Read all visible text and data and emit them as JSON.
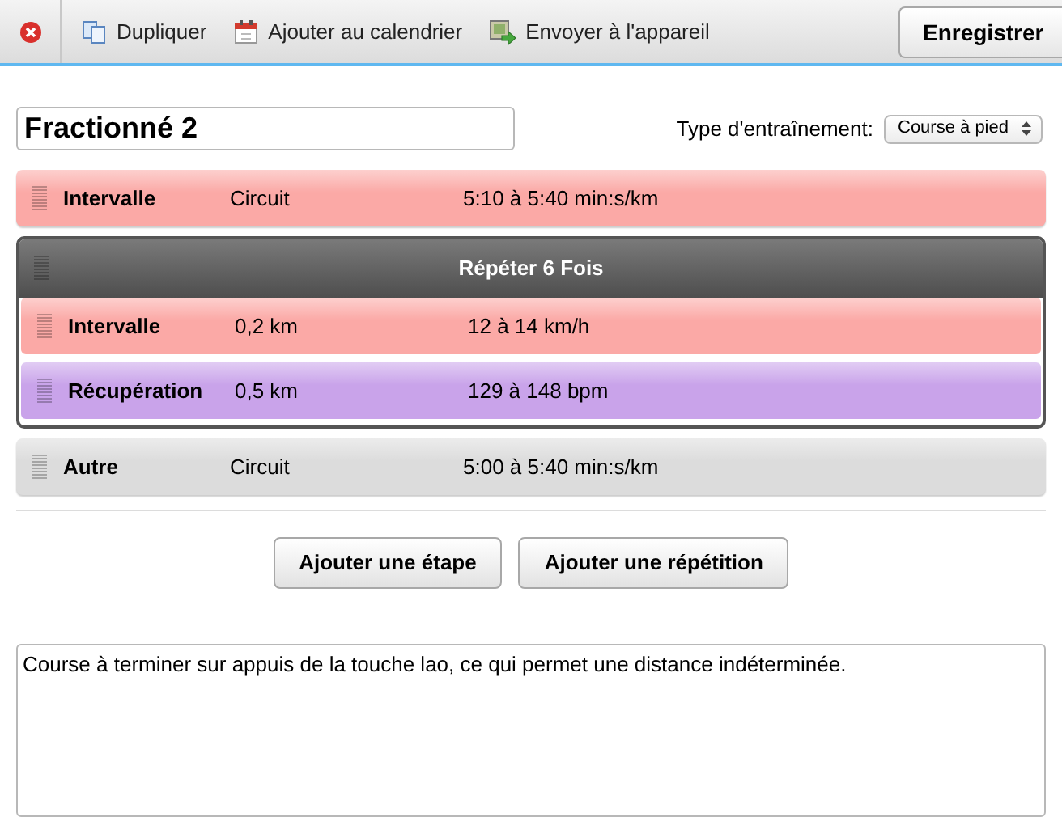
{
  "toolbar": {
    "actions": [
      {
        "kind": "duplicate",
        "label": "Dupliquer"
      },
      {
        "kind": "calendar",
        "label": "Ajouter au calendrier"
      },
      {
        "kind": "send",
        "label": "Envoyer à l'appareil"
      }
    ],
    "save_button": "Enregistrer"
  },
  "workout_name": {
    "value": "Fractionné 2"
  },
  "workout_type": {
    "label": "Type d'entraînement:",
    "value": "Course à pied"
  },
  "steps": [
    {
      "kind": "step",
      "color": "#fba9a6",
      "name": "Intervalle",
      "duration": "Circuit",
      "target": "5:10 à 5:40 min:s/km"
    },
    {
      "kind": "repeat",
      "label": "Répéter 6 Fois",
      "children": [
        {
          "kind": "step",
          "color": "#fba9a6",
          "name": "Intervalle",
          "duration": "0,2 km",
          "target": "12 à 14 km/h"
        },
        {
          "kind": "step",
          "color": "#c9a3ea",
          "name": "Récupération",
          "duration": "0,5 km",
          "target": "129 à 148 bpm"
        }
      ]
    },
    {
      "kind": "step",
      "color": "#dcdcdc",
      "name": "Autre",
      "duration": "Circuit",
      "target": "5:00 à 5:40 min:s/km"
    }
  ],
  "buttons": [
    "Ajouter une étape",
    "Ajouter une répétition"
  ],
  "notes": {
    "value": "Course à terminer sur appuis de la touche lao, ce qui permet une distance indéterminée."
  }
}
